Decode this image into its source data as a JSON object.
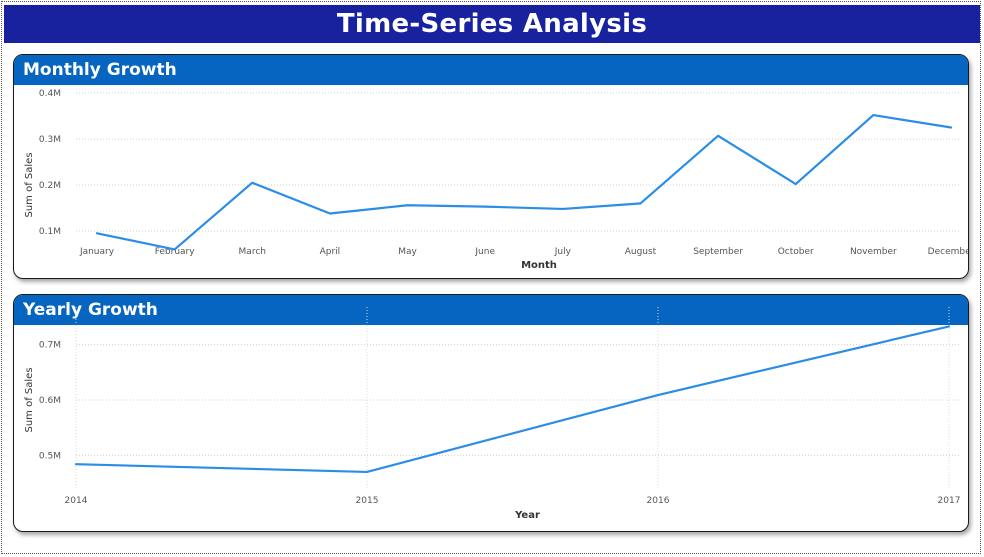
{
  "page_title": "Time-Series Analysis",
  "colors": {
    "banner": "#18229f",
    "panel_header": "#0565c0",
    "line": "#2a8de6"
  },
  "chart_data": [
    {
      "type": "line",
      "title": "Monthly Growth",
      "xlabel": "Month",
      "ylabel": "Sum of Sales",
      "categories": [
        "January",
        "February",
        "March",
        "April",
        "May",
        "June",
        "July",
        "August",
        "September",
        "October",
        "November",
        "December"
      ],
      "values": [
        95000,
        60000,
        205000,
        138000,
        156000,
        153000,
        148000,
        160000,
        307000,
        202000,
        352000,
        325000
      ],
      "ylim": [
        0,
        400000
      ],
      "yticks": [
        100000,
        200000,
        300000,
        400000
      ],
      "ytick_labels": [
        "0.1M",
        "0.2M",
        "0.3M",
        "0.4M"
      ],
      "grid": true
    },
    {
      "type": "line",
      "title": "Yearly Growth",
      "xlabel": "Year",
      "ylabel": "Sum of Sales",
      "categories": [
        "2014",
        "2015",
        "2016",
        "2017"
      ],
      "values": [
        484000,
        470000,
        609000,
        733000
      ],
      "ylim": [
        450000.0,
        750000.0
      ],
      "yticks": [
        500000,
        600000,
        700000
      ],
      "ytick_labels": [
        "0.5M",
        "0.6M",
        "0.7M"
      ],
      "grid": true
    }
  ]
}
